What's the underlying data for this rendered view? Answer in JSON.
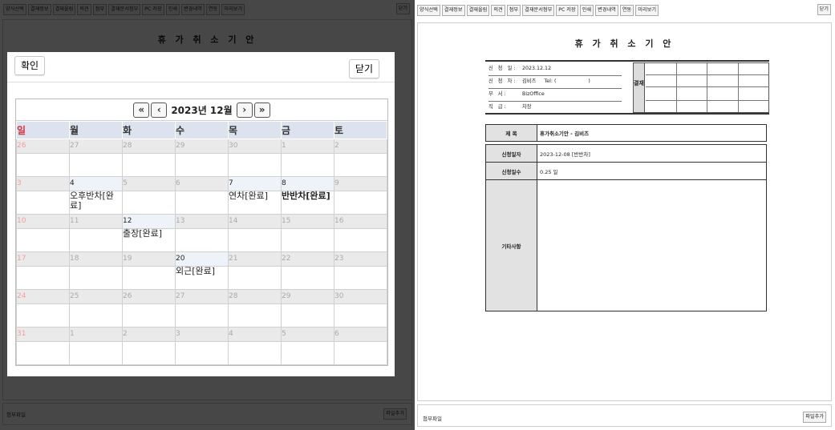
{
  "toolbar": {
    "buttons": [
      "양식선택",
      "결재정보",
      "결재올림",
      "의견",
      "첨부",
      "결재문서첨부",
      "PC 저장",
      "인쇄",
      "변경내역",
      "연동",
      "미리보기"
    ],
    "close_label": "닫기"
  },
  "document": {
    "title": "휴 가 취 소 기 안",
    "info": {
      "apply_date_label": "신 청 일:",
      "apply_date": "2023.12.12",
      "applicant_label": "신 청 자:",
      "applicant": "김비즈",
      "tel_label": "Tel: (",
      "tel_close": ")",
      "department_label": "부    서:",
      "department": "BizOffice",
      "position_label": "직    급:",
      "position": "차장"
    },
    "approval_label": "결재",
    "form": {
      "subject_label": "제    목",
      "subject": "휴가취소기안 - 김비즈",
      "apply_day_label": "신청일자",
      "apply_day": "2023-12-08 [반반차]",
      "apply_count_label": "신청일수",
      "apply_count": "0.25 일",
      "etc_label": "기타사항",
      "etc": ""
    }
  },
  "attach": {
    "label": "첨부파일",
    "add_button": "파일추가"
  },
  "modal": {
    "confirm_label": "확인",
    "close_label": "닫기",
    "calendar": {
      "nav": {
        "prev_year": "«",
        "prev_month": "‹",
        "title": "2023년 12월",
        "next_month": "›",
        "next_year": "»"
      },
      "weekdays": [
        "일",
        "월",
        "화",
        "수",
        "목",
        "금",
        "토"
      ],
      "weeks": [
        {
          "days": [
            {
              "num": "26",
              "cur": false
            },
            {
              "num": "27",
              "cur": false
            },
            {
              "num": "28",
              "cur": false
            },
            {
              "num": "29",
              "cur": false
            },
            {
              "num": "30",
              "cur": false
            },
            {
              "num": "1",
              "cur": false
            },
            {
              "num": "2",
              "cur": false
            }
          ],
          "events": [
            "",
            "",
            "",
            "",
            "",
            "",
            ""
          ]
        },
        {
          "days": [
            {
              "num": "3",
              "cur": false
            },
            {
              "num": "4",
              "cur": true
            },
            {
              "num": "5",
              "cur": false
            },
            {
              "num": "6",
              "cur": false
            },
            {
              "num": "7",
              "cur": true
            },
            {
              "num": "8",
              "cur": true
            },
            {
              "num": "9",
              "cur": false
            }
          ],
          "events": [
            "",
            "오후반차[완료]",
            "",
            "",
            "연차[완료]",
            "반반차[완료]",
            ""
          ]
        },
        {
          "days": [
            {
              "num": "10",
              "cur": false
            },
            {
              "num": "11",
              "cur": false
            },
            {
              "num": "12",
              "cur": true
            },
            {
              "num": "13",
              "cur": false
            },
            {
              "num": "14",
              "cur": false
            },
            {
              "num": "15",
              "cur": false
            },
            {
              "num": "16",
              "cur": false
            }
          ],
          "events": [
            "",
            "",
            "출장[완료]",
            "",
            "",
            "",
            ""
          ]
        },
        {
          "days": [
            {
              "num": "17",
              "cur": false
            },
            {
              "num": "18",
              "cur": false
            },
            {
              "num": "19",
              "cur": false
            },
            {
              "num": "20",
              "cur": true
            },
            {
              "num": "21",
              "cur": false
            },
            {
              "num": "22",
              "cur": false
            },
            {
              "num": "23",
              "cur": false
            }
          ],
          "events": [
            "",
            "",
            "",
            "외근[완료]",
            "",
            "",
            ""
          ]
        },
        {
          "days": [
            {
              "num": "24",
              "cur": false
            },
            {
              "num": "25",
              "cur": false
            },
            {
              "num": "26",
              "cur": false
            },
            {
              "num": "27",
              "cur": false
            },
            {
              "num": "28",
              "cur": false
            },
            {
              "num": "29",
              "cur": false
            },
            {
              "num": "30",
              "cur": false
            }
          ],
          "events": [
            "",
            "",
            "",
            "",
            "",
            "",
            ""
          ]
        },
        {
          "days": [
            {
              "num": "31",
              "cur": false
            },
            {
              "num": "1",
              "cur": false
            },
            {
              "num": "2",
              "cur": false
            },
            {
              "num": "3",
              "cur": false
            },
            {
              "num": "4",
              "cur": false
            },
            {
              "num": "5",
              "cur": false
            },
            {
              "num": "6",
              "cur": false
            }
          ],
          "events": [
            "",
            "",
            "",
            "",
            "",
            "",
            ""
          ]
        }
      ]
    }
  },
  "colors": {
    "sunday": "#d8303c",
    "weekday_header_bg": "#dce3ee",
    "overlay": "#000000"
  }
}
